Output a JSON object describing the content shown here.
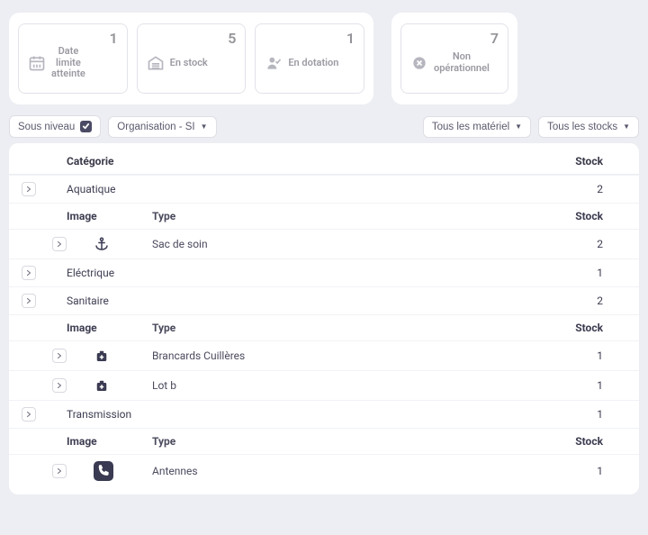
{
  "cards": {
    "date_limit": {
      "count": "1",
      "label": "Date\nlimite\natteinte"
    },
    "stock": {
      "count": "5",
      "label": "En stock"
    },
    "dotation": {
      "count": "1",
      "label": "En dotation"
    },
    "non_op": {
      "count": "7",
      "label": "Non\nopérationnel"
    }
  },
  "filters": {
    "sous_niveau": "Sous niveau",
    "organisation": "Organisation - SI",
    "materiel": "Tous les matériel",
    "stocks": "Tous les stocks"
  },
  "columns": {
    "categorie": "Catégorie",
    "stock": "Stock",
    "image": "Image",
    "type": "Type"
  },
  "categories": [
    {
      "name": "Aquatique",
      "stock": "2",
      "children": [
        {
          "icon": "anchor",
          "type": "Sac de soin",
          "stock": "2"
        }
      ]
    },
    {
      "name": "Eléctrique",
      "stock": "1",
      "children": []
    },
    {
      "name": "Sanitaire",
      "stock": "2",
      "children": [
        {
          "icon": "medkit",
          "type": "Brancards Cuillères",
          "stock": "1"
        },
        {
          "icon": "medkit",
          "type": "Lot b",
          "stock": "1"
        }
      ]
    },
    {
      "name": "Transmission",
      "stock": "1",
      "children": [
        {
          "icon": "phone",
          "type": "Antennes",
          "stock": "1"
        }
      ]
    }
  ]
}
